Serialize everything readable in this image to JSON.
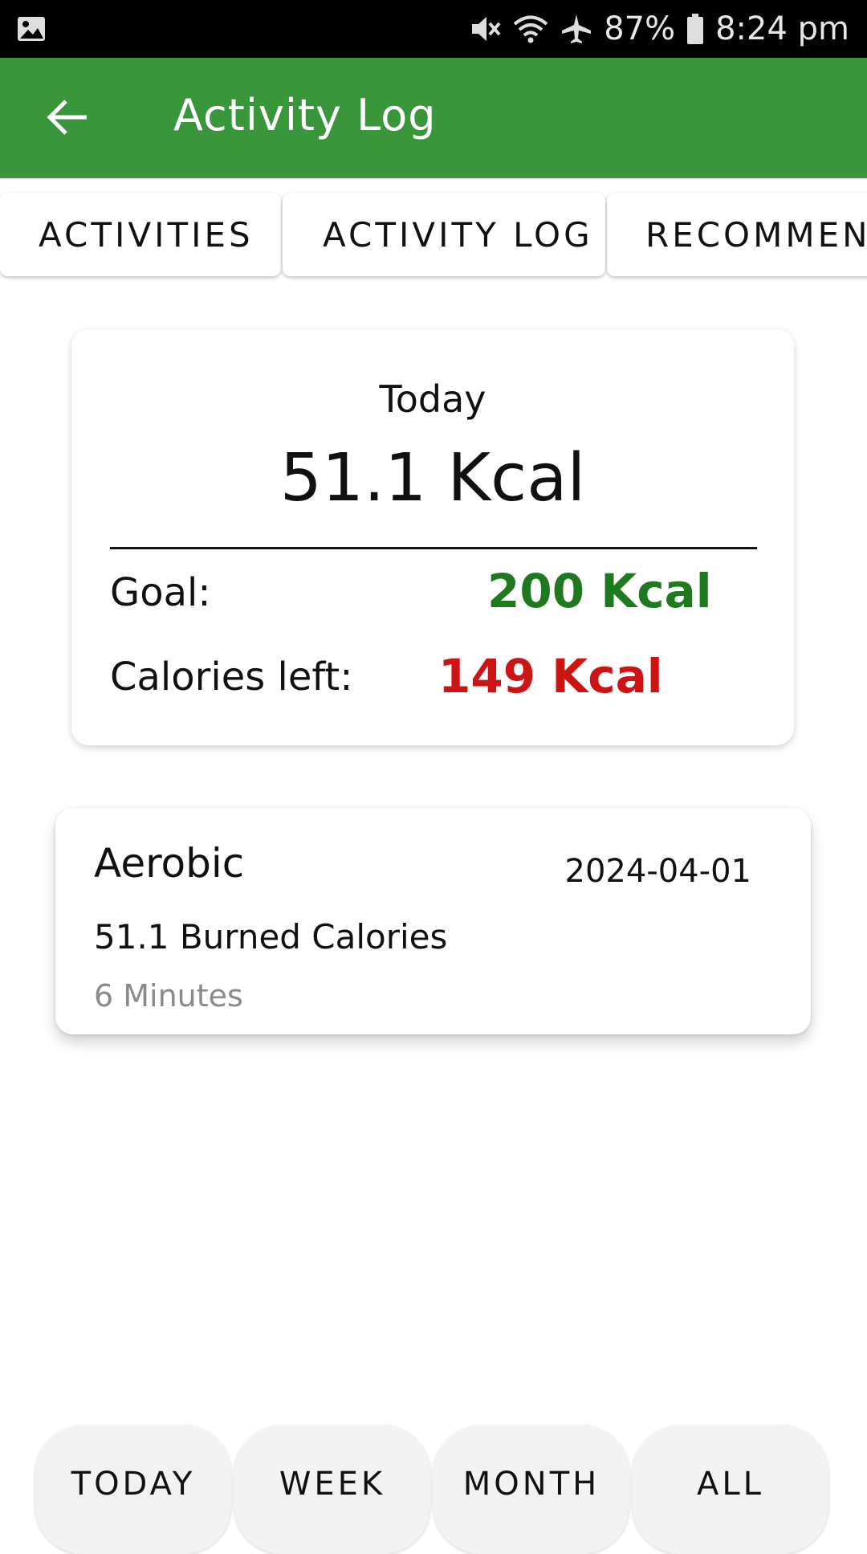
{
  "status_bar": {
    "battery": "87%",
    "time": "8:24 pm",
    "icons": [
      "gallery-icon",
      "vibrate-mute-icon",
      "wifi-icon",
      "airplane-icon",
      "battery-icon"
    ]
  },
  "app_bar": {
    "title": "Activity Log",
    "back_icon": "back-arrow-icon",
    "color": "#3a963a"
  },
  "tabs": [
    {
      "label": "ACTIVITIES"
    },
    {
      "label": "ACTIVITY LOG"
    },
    {
      "label": "RECOMMEND"
    }
  ],
  "summary": {
    "period": "Today",
    "total": "51.1 Kcal",
    "goal_label": "Goal:",
    "goal_value": "200 Kcal",
    "left_label": "Calories left:",
    "left_value": "149 Kcal",
    "goal_color": "#1f7a1f",
    "left_color": "#cc1414"
  },
  "entries": [
    {
      "name": "Aerobic",
      "date": "2024-04-01",
      "burned": "51.1 Burned Calories",
      "minutes": "6 Minutes"
    }
  ],
  "filters": [
    {
      "label": "TODAY"
    },
    {
      "label": "WEEK"
    },
    {
      "label": "MONTH"
    },
    {
      "label": "ALL"
    }
  ]
}
